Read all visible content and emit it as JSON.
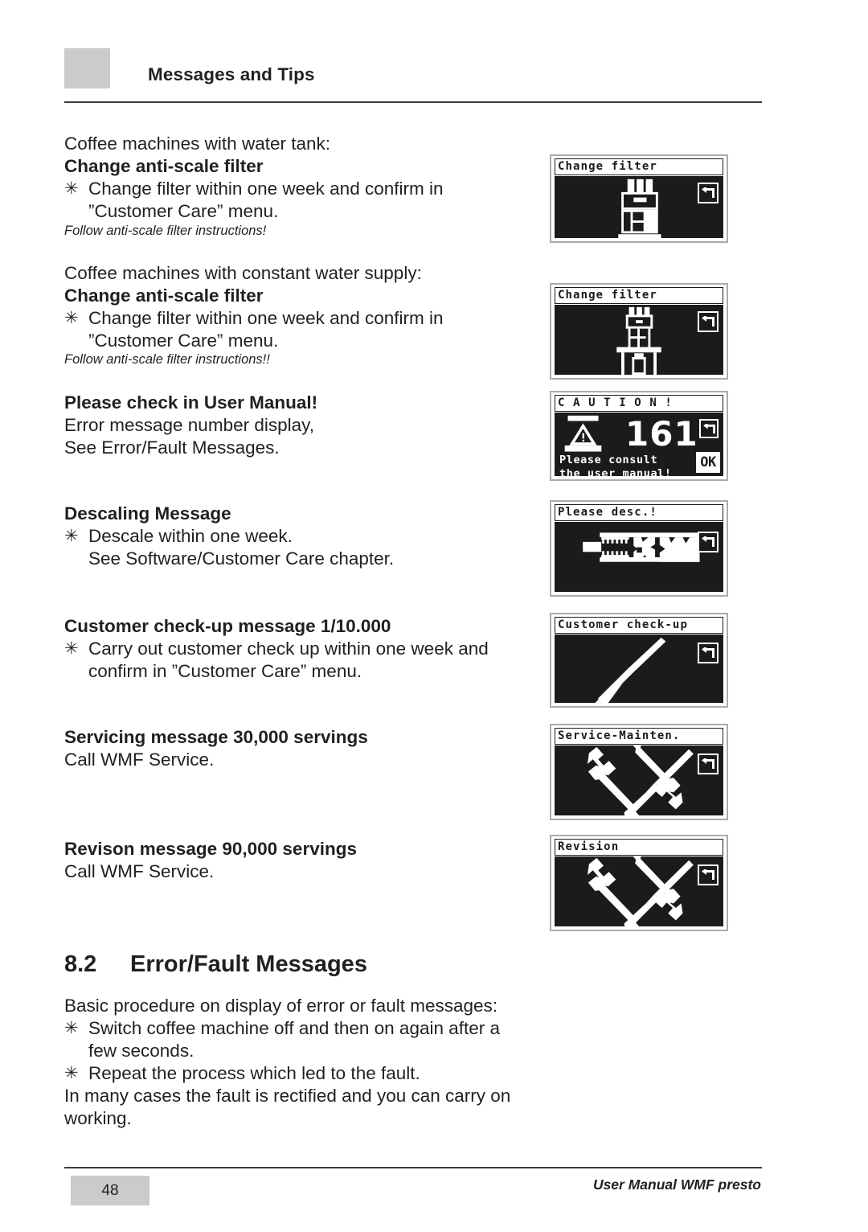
{
  "header": {
    "title": "Messages and Tips"
  },
  "footer": {
    "page_number": "48",
    "doc_label": "User Manual WMF presto"
  },
  "sections": {
    "water_tank": {
      "lead": "Coffee machines with water tank:",
      "heading": "Change anti-scale filter",
      "bullet": "Change filter within one week and confirm in\n”Customer Care” menu.",
      "note": "Follow anti-scale filter instructions!"
    },
    "constant_supply": {
      "lead": "Coffee machines with constant water supply:",
      "heading": "Change anti-scale filter",
      "bullet": "Change filter within one week and confirm in\n”Customer Care” menu.",
      "note": "Follow anti-scale filter instructions!!"
    },
    "user_manual": {
      "heading": "Please check in User Manual!",
      "line1": "Error message number display,",
      "line2": "See Error/Fault Messages."
    },
    "descaling": {
      "heading": "Descaling Message",
      "bullet": "Descale within one week.\nSee Software/Customer Care chapter."
    },
    "customer_checkup": {
      "heading": "Customer check-up message 1/10.000",
      "bullet": "Carry out customer check up within one week and\nconfirm in ”Customer Care” menu."
    },
    "servicing": {
      "heading": "Servicing message 30,000 servings",
      "line1": "Call WMF Service."
    },
    "revision": {
      "heading": "Revison message 90,000 servings",
      "line1": "Call WMF Service."
    },
    "error_fault": {
      "number": "8.2",
      "title": "Error/Fault Messages",
      "intro": "Basic procedure on display of error or fault messages:",
      "bullet1": "Switch coffee machine off and then on again after a\nfew seconds.",
      "bullet2": "Repeat the process which led to the fault.",
      "outro": "In many cases the fault is rectified and you can carry on\nworking."
    }
  },
  "bullet_marker": "✳",
  "displays": [
    {
      "id": "change-filter-tank",
      "title": "Change filter",
      "art": "coffee-machine-with-tank",
      "softkey": "back-arrow-icon"
    },
    {
      "id": "change-filter-supply",
      "title": "Change filter",
      "art": "coffee-machine-on-counter",
      "softkey": "back-arrow-icon"
    },
    {
      "id": "caution-161",
      "title": "C A U T I O N !",
      "art": "warning-triangle-icon",
      "error_code": "161",
      "message_line1": "Please consult",
      "message_line2": "the user manual!",
      "softkey": "back-arrow-icon",
      "softkey2_label": "OK"
    },
    {
      "id": "please-descale",
      "title": "Please desc.!",
      "art": "scaled-pipe-icon",
      "softkey": "back-arrow-icon"
    },
    {
      "id": "customer-check-up",
      "title": "Customer check-up",
      "art": "screwdriver-icon",
      "softkey": "back-arrow-icon"
    },
    {
      "id": "service-maintenance",
      "title": "Service-Mainten.",
      "art": "wrench-screwdriver-icon",
      "softkey": "back-arrow-icon"
    },
    {
      "id": "revision",
      "title": "Revision",
      "art": "wrench-screwdriver-icon",
      "softkey": "back-arrow-icon"
    }
  ],
  "colors": {
    "ink": "#231f20",
    "swatch_gray": "#c9cbcd",
    "lcd_background": "#1b1b1b",
    "lcd_foreground": "#ffffff"
  }
}
